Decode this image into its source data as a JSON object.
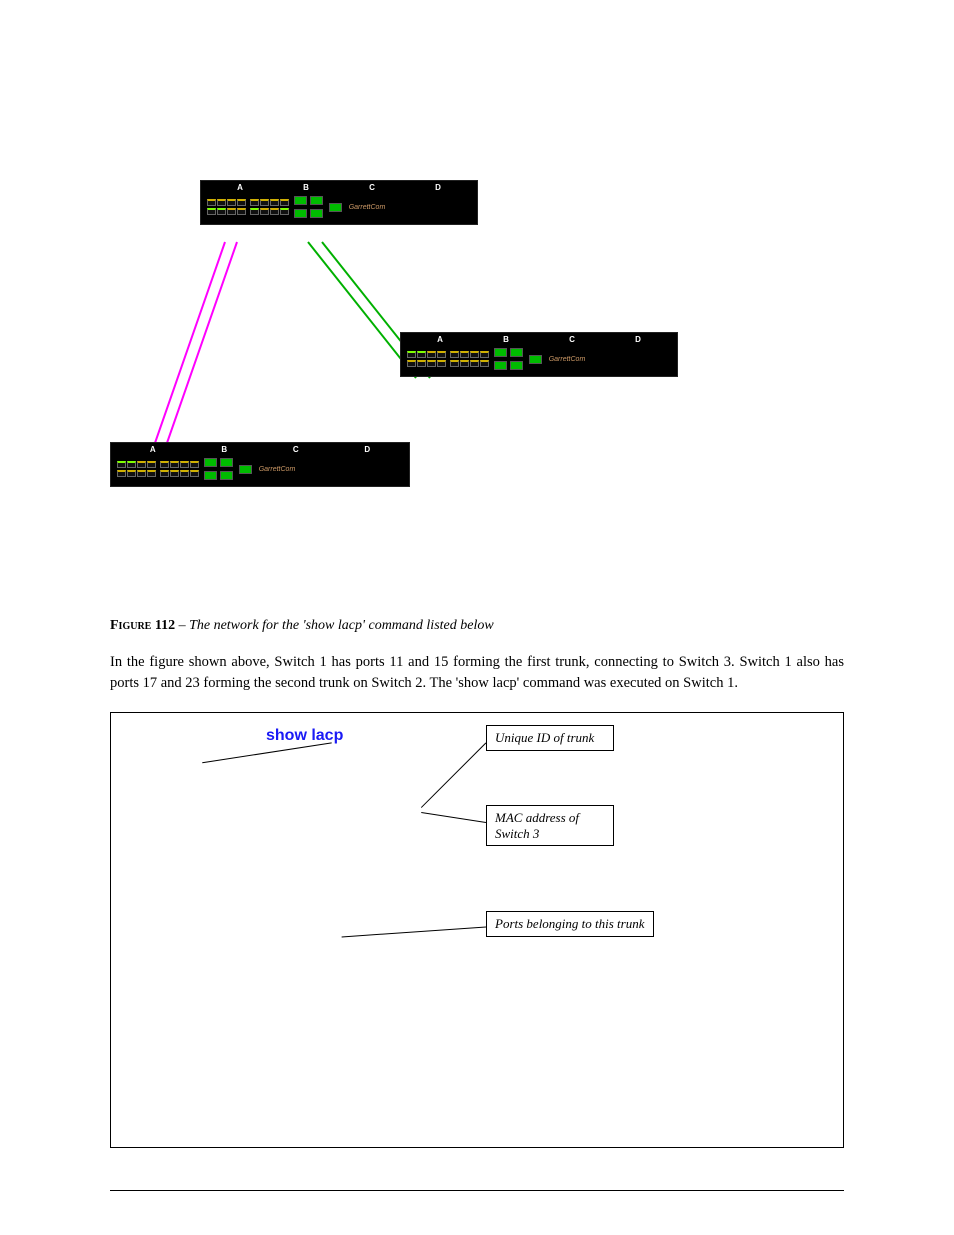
{
  "switch_sections": [
    "A",
    "B",
    "C",
    "D"
  ],
  "brand": "GarrettCom",
  "caption_label": "Figure 112",
  "caption_sep": " – ",
  "caption_text": "The network for the 'show lacp' command listed below",
  "body": "In the figure shown above, Switch 1 has ports 11 and 15 forming the first trunk, connecting to Switch 3. Switch 1 also has ports 17 and 23 forming the second trunk on Switch 2. The 'show lacp' command was executed on Switch 1.",
  "command": "show lacp",
  "callouts": {
    "a": "Unique ID of trunk",
    "b": "MAC address of Switch 3",
    "c": "Ports belonging to this trunk"
  }
}
